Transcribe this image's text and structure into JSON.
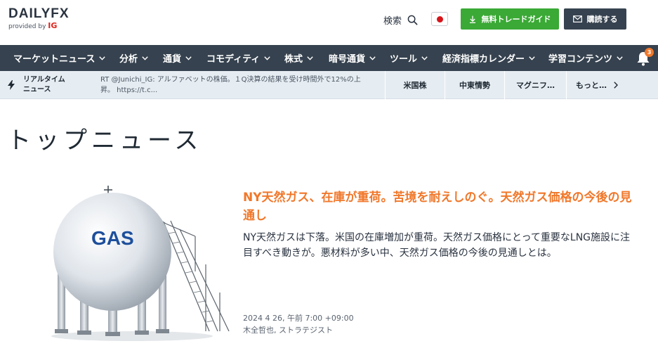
{
  "header": {
    "logo_text": "DAILYFX",
    "logo_provided_by": "provided by",
    "logo_brand": "IG",
    "search_label": "検索",
    "trade_guide_label": "無料トレードガイド",
    "subscribe_label": "購読する"
  },
  "nav": {
    "items": [
      {
        "label": "マーケットニュース"
      },
      {
        "label": "分析"
      },
      {
        "label": "通貨"
      },
      {
        "label": "コモディティ"
      },
      {
        "label": "株式"
      },
      {
        "label": "暗号通貨"
      },
      {
        "label": "ツール"
      },
      {
        "label": "経済指標カレンダー"
      },
      {
        "label": "学習コンテンツ"
      }
    ],
    "notification_count": "3"
  },
  "realtime": {
    "title": "リアルタイム ニュース",
    "text": "RT @Junichi_IG: アルファベットの株価。１Q決算の結果を受け時間外で12%の上昇。 https://t.c...",
    "tags": [
      "米国株",
      "中東情勢",
      "マグニフ…",
      "もっと…"
    ]
  },
  "main": {
    "page_title": "トップニュース",
    "image_label": "GAS",
    "article": {
      "headline": "NY天然ガス、在庫が重荷。苦境を耐えしのぐ。天然ガス価格の今後の見通し",
      "summary": "NY天然ガスは下落。米国の在庫増加が重荷。天然ガス価格にとって重要なLNG施設に注目すべき動きが。悪材料が多い中、天然ガス価格の今後の見通しとは。",
      "date": "2024 4 26, 午前 7:00 +09:00",
      "author": "木全哲也, ストラテジスト"
    }
  },
  "colors": {
    "accent_orange": "#f0782b",
    "nav_bg": "#36424f",
    "trade_green": "#3aa935",
    "gas_blue": "#1d4f9c"
  },
  "icons": {
    "search": "search-icon",
    "download": "download-icon",
    "mail": "mail-icon",
    "chevron": "chevron-down-icon",
    "bell": "bell-icon",
    "lightning": "lightning-icon",
    "chevron_right": "chevron-right-icon"
  }
}
